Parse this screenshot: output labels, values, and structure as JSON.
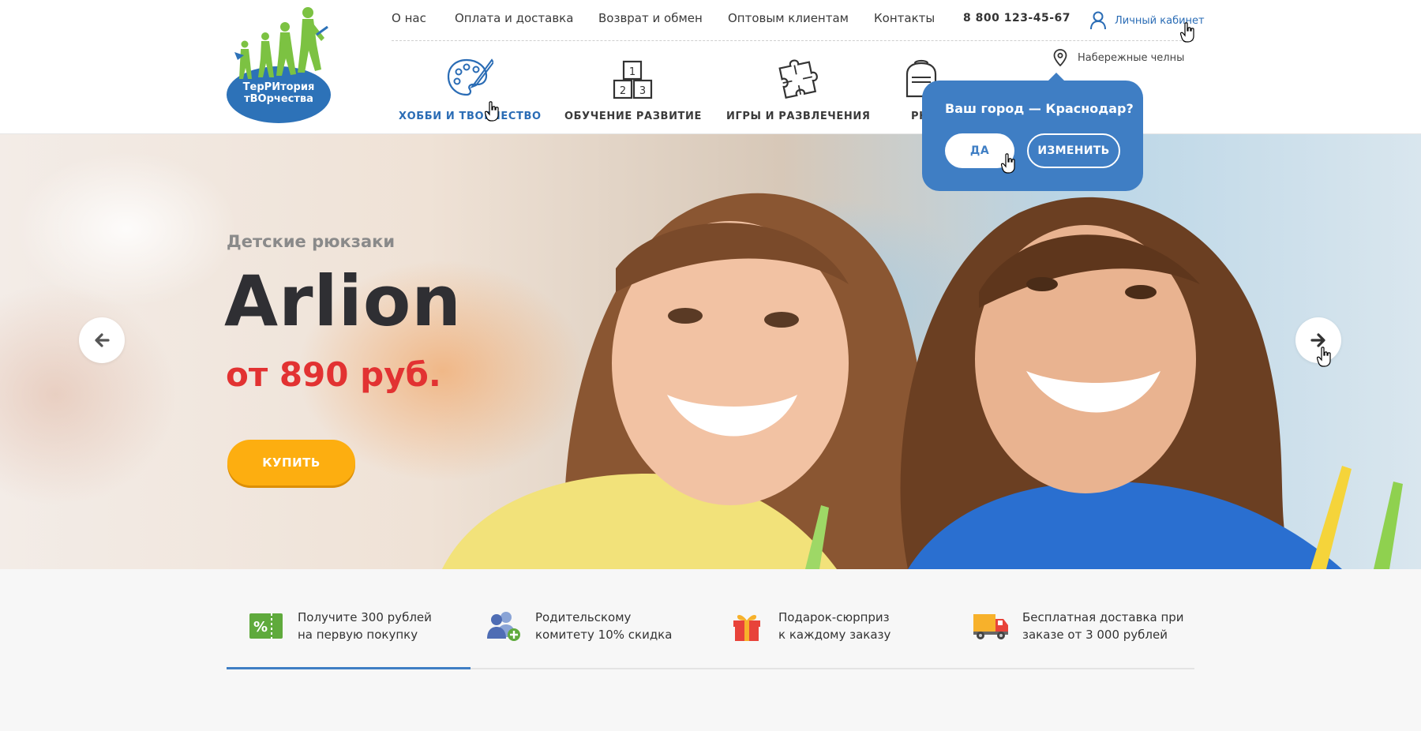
{
  "logo": {
    "line1": "ТерРИтория",
    "line2": "тВОрчества"
  },
  "topnav": {
    "links": [
      "О нас",
      "Оплата и доставка",
      "Возврат и обмен",
      "Оптовым клиентам",
      "Контакты"
    ],
    "phone": "8 800 123-45-67",
    "account_label": "Личный кабинет"
  },
  "city": {
    "current": "Набережные челны"
  },
  "categories": [
    {
      "label": "ХОББИ И ТВОРЧЕСТВО",
      "icon": "palette-icon",
      "active": true
    },
    {
      "label": "ОБУЧЕНИЕ РАЗВИТИЕ",
      "icon": "number-blocks-icon",
      "active": false
    },
    {
      "label": "ИГРЫ И РАЗВЛЕЧЕНИЯ",
      "icon": "puzzle-icon",
      "active": false
    },
    {
      "label": "РЮ",
      "icon": "backpack-icon",
      "active": false
    }
  ],
  "city_popup": {
    "question": "Ваш город — Краснодар?",
    "yes_label": "ДА",
    "change_label": "ИЗМЕНИТЬ"
  },
  "hero": {
    "subtitle": "Детские рюкзаки",
    "brand": "Arlion",
    "price": "от 890 руб.",
    "buy_label": "КУПИТЬ"
  },
  "benefits": [
    {
      "line1": "Получите 300 рублей",
      "line2": "на первую покупку",
      "icon": "percent-coupon-icon"
    },
    {
      "line1": "Родительскому",
      "line2": "комитету 10% скидка",
      "icon": "group-plus-icon"
    },
    {
      "line1": "Подарок-сюрприз",
      "line2": "к каждому заказу",
      "icon": "gift-icon"
    },
    {
      "line1": "Бесплатная доставка при",
      "line2": "заказе от 3 000 рублей",
      "icon": "delivery-truck-icon"
    }
  ],
  "colors": {
    "accent_blue": "#3f7ec4",
    "price_red": "#e23232",
    "buy_orange": "#fdae10",
    "logo_green": "#7cc242",
    "logo_blue": "#2d72b8"
  }
}
